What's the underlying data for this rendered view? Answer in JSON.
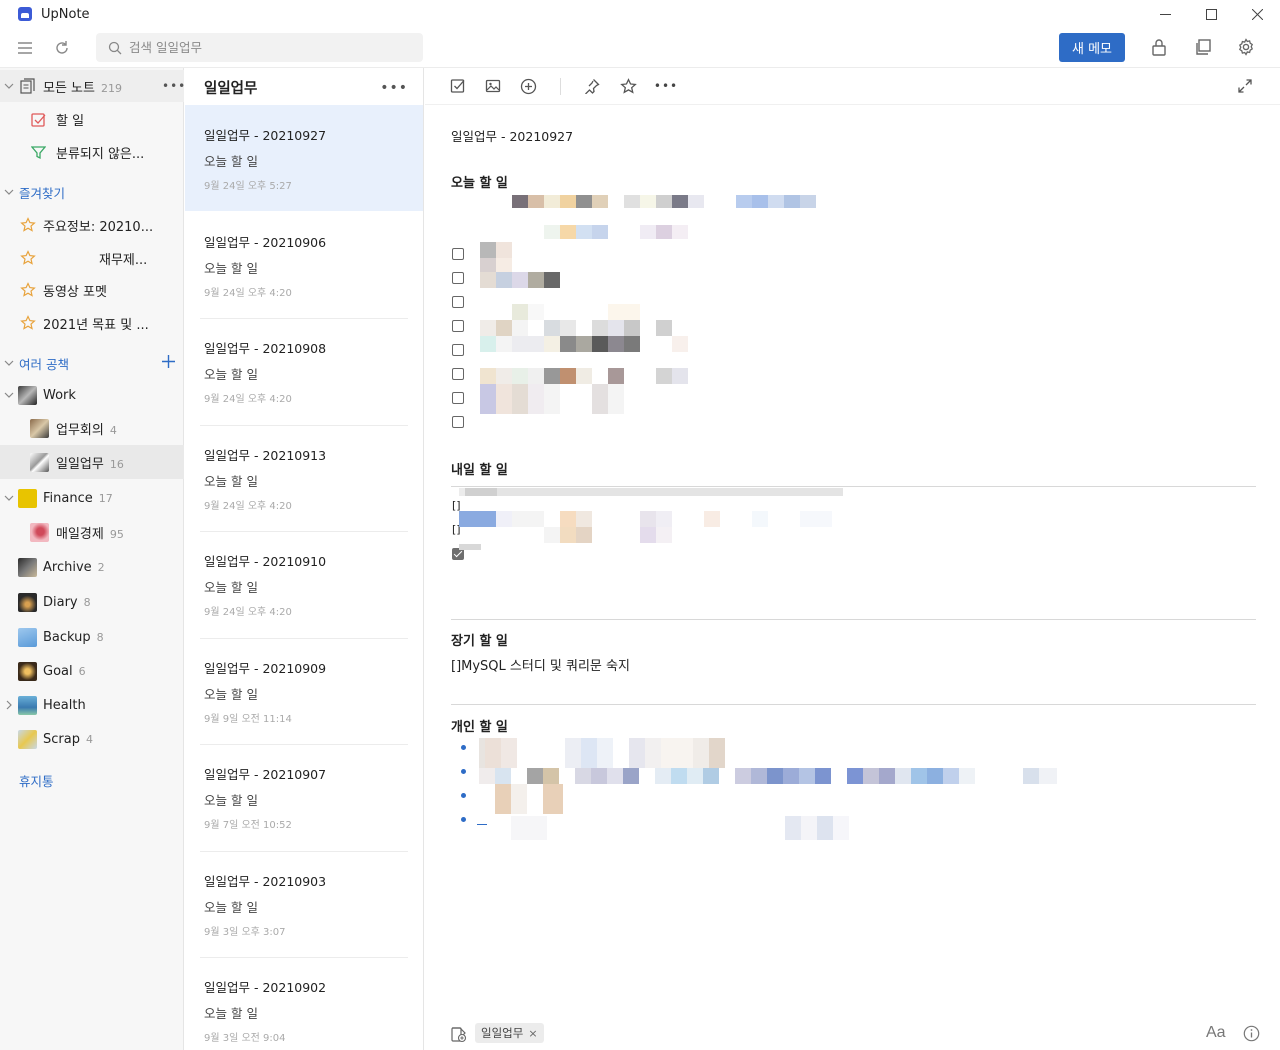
{
  "app": {
    "title": "UpNote"
  },
  "window": {
    "minimize": "—",
    "maximize": "☐",
    "close": "✕"
  },
  "toolbar": {
    "search_placeholder": "검색 일일업무",
    "new_memo": "새 메모"
  },
  "sidebar": {
    "all_notes": {
      "label": "모든 노트",
      "count": "219"
    },
    "todo": "할 일",
    "uncategorized": "분류되지 않은...",
    "favorites_title": "즐겨찾기",
    "favorites": [
      "주요정보: 20210...",
      "재무제...",
      "동영상 포멧",
      "2021년 목표 및 ..."
    ],
    "workspaces_title": "여러 공책",
    "notebooks": [
      {
        "label": "Work",
        "count": ""
      },
      {
        "label": "업무회의",
        "count": "4"
      },
      {
        "label": "일일업무",
        "count": "16"
      },
      {
        "label": "Finance",
        "count": "17"
      },
      {
        "label": "매일경제",
        "count": "95"
      },
      {
        "label": "Archive",
        "count": "2"
      },
      {
        "label": "Diary",
        "count": "8"
      },
      {
        "label": "Backup",
        "count": "8"
      },
      {
        "label": "Goal",
        "count": "6"
      },
      {
        "label": "Health",
        "count": ""
      },
      {
        "label": "Scrap",
        "count": "4"
      }
    ],
    "trash": "휴지통"
  },
  "notelist": {
    "title": "일일업무",
    "more": "•••",
    "notes": [
      {
        "title": "일일업무 - 20210927",
        "snippet": "오늘 할 일",
        "date": "9월 24일 오후 5:27"
      },
      {
        "title": "일일업무 - 20210906",
        "snippet": "오늘 할 일",
        "date": "9월 24일 오후 4:20"
      },
      {
        "title": "일일업무 - 20210908",
        "snippet": "오늘 할 일",
        "date": "9월 24일 오후 4:20"
      },
      {
        "title": "일일업무 - 20210913",
        "snippet": "오늘 할 일",
        "date": "9월 24일 오후 4:20"
      },
      {
        "title": "일일업무 - 20210910",
        "snippet": "오늘 할 일",
        "date": "9월 24일 오후 4:20"
      },
      {
        "title": "일일업무 - 20210909",
        "snippet": "오늘 할 일",
        "date": "9월 9일 오전 11:14"
      },
      {
        "title": "일일업무 - 20210907",
        "snippet": "오늘 할 일",
        "date": "9월 7일 오전 10:52"
      },
      {
        "title": "일일업무 - 20210903",
        "snippet": "오늘 할 일",
        "date": "9월 3일 오후 3:07"
      },
      {
        "title": "일일업무 - 20210902",
        "snippet": "오늘 할 일",
        "date": "9월 3일 오전 9:04"
      }
    ]
  },
  "editor": {
    "title": "일일업무 - 20210927",
    "today_heading": "오늘 할 일",
    "tomorrow_heading": "내일 할 일",
    "tomorrow_brackets": [
      "[]",
      "[]"
    ],
    "longterm_heading": "장기 할 일",
    "longterm_item": "[]MySQL 스터디 및 쿼리문 숙지",
    "personal_heading": "개인 할 일",
    "tag": "일일업무",
    "tag_remove": "×",
    "font_button": "Aa"
  },
  "colors": {
    "accent": "#2e6cc6",
    "selected": "#e8f0fc"
  }
}
